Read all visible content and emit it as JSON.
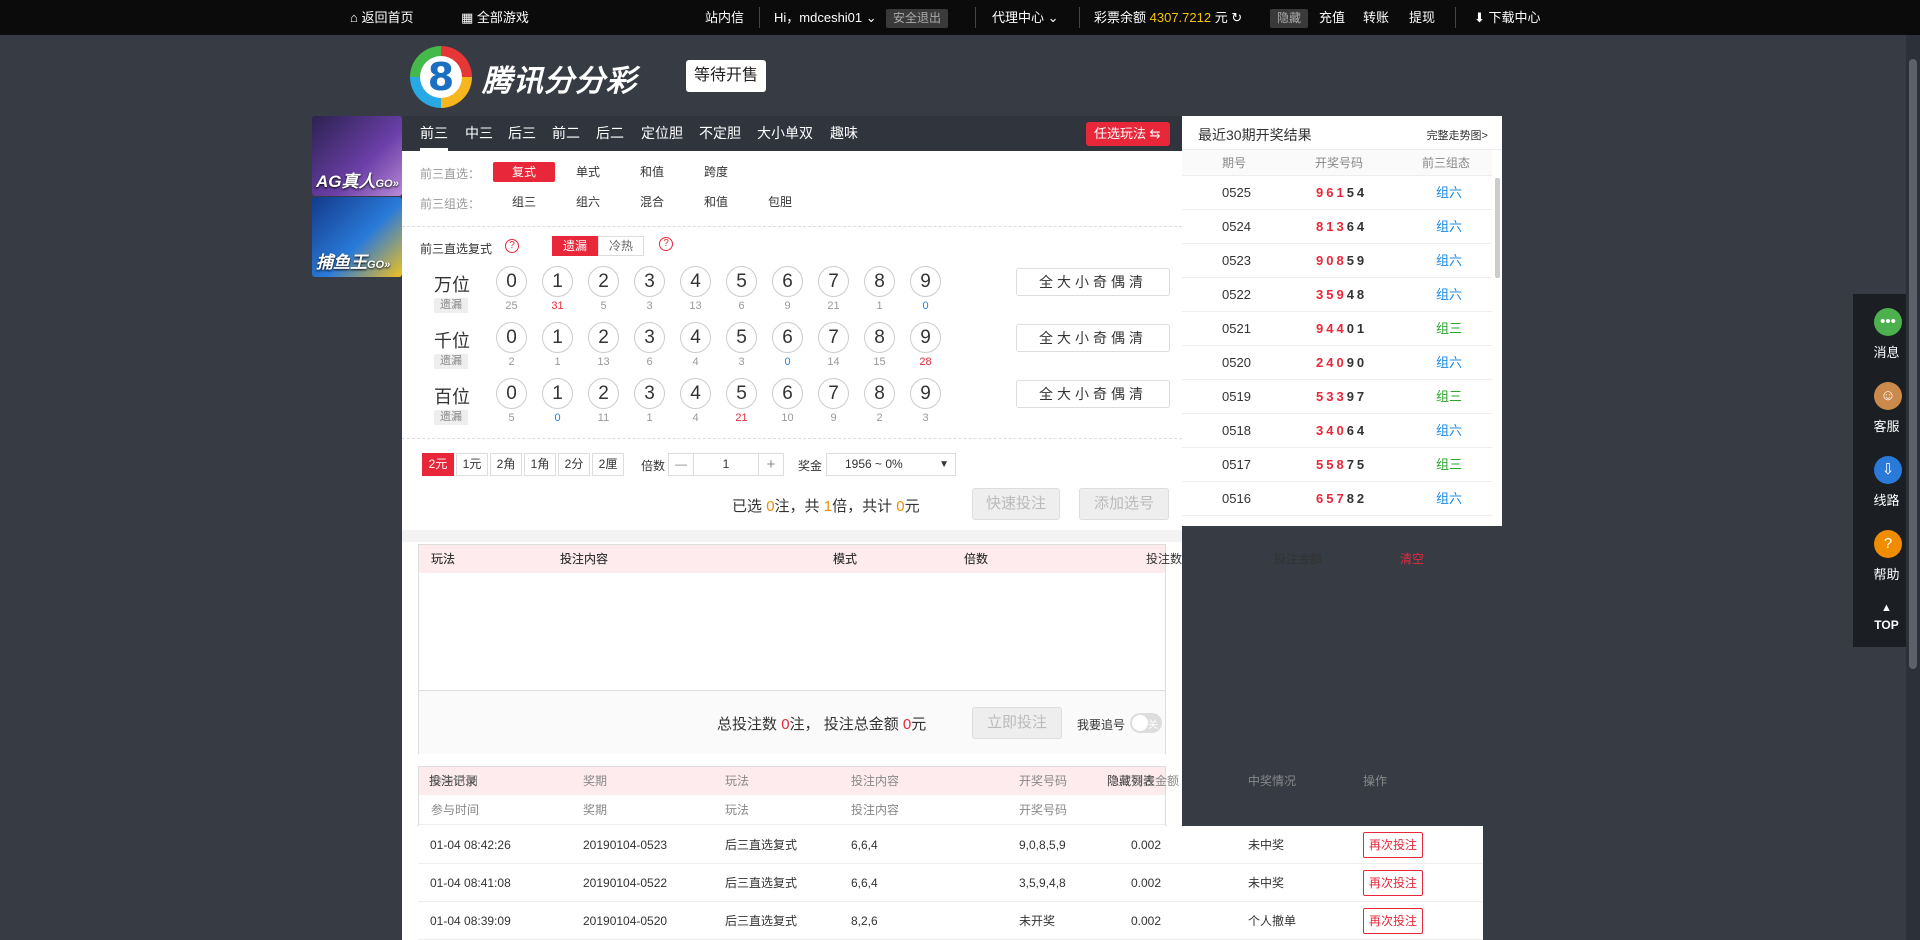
{
  "topbar": {
    "home": "返回首页",
    "all_games": "全部游戏",
    "messages": "站内信",
    "greeting": "Hi，mdceshi01",
    "logout": "安全退出",
    "agent": "代理中心",
    "balance_label": "彩票余额",
    "balance_value": "4307.7212",
    "balance_unit": "元",
    "hide": "隐藏",
    "recharge": "充值",
    "transfer": "转账",
    "withdraw": "提现",
    "download": "下载中心"
  },
  "header": {
    "logo_digit": "8",
    "brand": "腾讯分分彩",
    "status": "等待开售"
  },
  "promos": [
    "AG真人",
    "捕鱼王"
  ],
  "promo_go": "GO»",
  "game_tabs": [
    "前三",
    "中三",
    "后三",
    "前二",
    "后二",
    "定位胆",
    "不定胆",
    "大小单双",
    "趣味"
  ],
  "optional_play": "任选玩法",
  "sub_rows": {
    "row1_label": "前三直选：",
    "row1": [
      "复式",
      "单式",
      "和值",
      "跨度"
    ],
    "row2_label": "前三组选：",
    "row2": [
      "组三",
      "组六",
      "混合",
      "和值",
      "包胆"
    ]
  },
  "play": {
    "title": "前三直选复式",
    "miss": "遗漏",
    "hot": "冷热",
    "help": "?"
  },
  "positions": [
    {
      "name": "万位",
      "miss_label": "遗漏",
      "miss": [
        "25",
        "31",
        "5",
        "3",
        "13",
        "6",
        "9",
        "21",
        "1",
        "0"
      ]
    },
    {
      "name": "千位",
      "miss_label": "遗漏",
      "miss": [
        "2",
        "1",
        "13",
        "6",
        "4",
        "3",
        "0",
        "14",
        "15",
        "28"
      ]
    },
    {
      "name": "百位",
      "miss_label": "遗漏",
      "miss": [
        "5",
        "0",
        "11",
        "1",
        "4",
        "21",
        "10",
        "9",
        "2",
        "3"
      ]
    }
  ],
  "digits": [
    "0",
    "1",
    "2",
    "3",
    "4",
    "5",
    "6",
    "7",
    "8",
    "9"
  ],
  "quick_select": "全大小奇偶清",
  "units": [
    "2元",
    "1元",
    "2角",
    "1角",
    "2分",
    "2厘"
  ],
  "multiple_label": "倍数",
  "multiple_minus": "—",
  "multiple_value": "1",
  "multiple_plus": "+",
  "prize_label": "奖金",
  "prize_value": "1956 ~ 0%",
  "selection": {
    "p1": "已选",
    "count": "0",
    "p2": "注，共",
    "times": "1",
    "p3": "倍，共计",
    "amount": "0",
    "p4": "元",
    "quick_bet": "快速投注",
    "add_number": "添加选号"
  },
  "cart": {
    "headers": [
      "玩法",
      "投注内容",
      "模式",
      "倍数",
      "投注数",
      "投注金额"
    ],
    "clear": "清空",
    "total_p1": "总投注数",
    "total_count": "0",
    "total_p2": "注，  投注总金额",
    "total_amount": "0",
    "total_p3": "元",
    "bet_now": "立即投注",
    "chase": "我要追号",
    "switch_off": "关"
  },
  "records": {
    "title": "投注记录",
    "hide_list": "隐藏列表",
    "headers": [
      "参与时间",
      "奖期",
      "玩法",
      "投注内容",
      "开奖号码",
      "投注金额",
      "中奖情况",
      "操作"
    ],
    "rows": [
      {
        "time": "01-04 08:42:26",
        "period": "20190104-0523",
        "play": "后三直选复式",
        "content": "6,6,4",
        "draw": "9,0,8,5,9",
        "amount": "0.002",
        "status": "未中奖",
        "action": "再次投注"
      },
      {
        "time": "01-04 08:41:08",
        "period": "20190104-0522",
        "play": "后三直选复式",
        "content": "6,6,4",
        "draw": "3,5,9,4,8",
        "amount": "0.002",
        "status": "未中奖",
        "action": "再次投注"
      },
      {
        "time": "01-04 08:39:09",
        "period": "20190104-0520",
        "play": "后三直选复式",
        "content": "8,2,6",
        "draw": "未开奖",
        "amount": "0.002",
        "status": "个人撤单",
        "action": "再次投注"
      }
    ]
  },
  "results": {
    "title": "最近30期开奖结果",
    "trend": "完整走势图>",
    "headers": [
      "期号",
      "开奖号码",
      "前三组态"
    ],
    "rows": [
      {
        "period": "0525",
        "red": "961",
        "rest": "54",
        "form": "组六"
      },
      {
        "period": "0524",
        "red": "813",
        "rest": "64",
        "form": "组六"
      },
      {
        "period": "0523",
        "red": "908",
        "rest": "59",
        "form": "组六"
      },
      {
        "period": "0522",
        "red": "359",
        "rest": "48",
        "form": "组六"
      },
      {
        "period": "0521",
        "red": "944",
        "rest": "01",
        "form": "组三"
      },
      {
        "period": "0520",
        "red": "240",
        "rest": "90",
        "form": "组六"
      },
      {
        "period": "0519",
        "red": "533",
        "rest": "97",
        "form": "组三"
      },
      {
        "period": "0518",
        "red": "340",
        "rest": "64",
        "form": "组六"
      },
      {
        "period": "0517",
        "red": "558",
        "rest": "75",
        "form": "组三"
      },
      {
        "period": "0516",
        "red": "657",
        "rest": "82",
        "form": "组六"
      }
    ]
  },
  "right_tools": [
    {
      "label": "消息",
      "icon": "chat-icon"
    },
    {
      "label": "客服",
      "icon": "service-icon"
    },
    {
      "label": "线路",
      "icon": "route-icon"
    },
    {
      "label": "帮助",
      "icon": "help-icon"
    },
    {
      "label": "TOP",
      "icon": "top-arrow-icon"
    }
  ],
  "colors": {
    "accent_red": "#e8283a",
    "balance_yellow": "#f5c400",
    "group_six_blue": "#1a8ae6",
    "group_three_green": "#2aa52a",
    "tabs_bg": "#2f343d",
    "page_bg": "#363b44"
  }
}
